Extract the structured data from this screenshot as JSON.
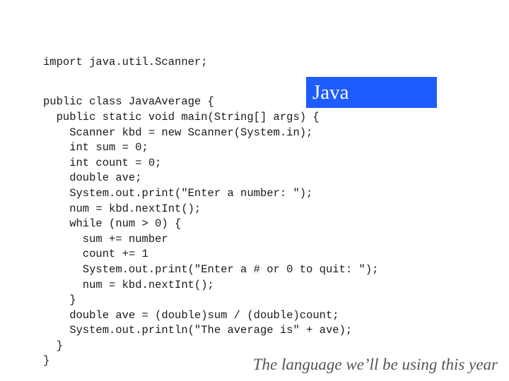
{
  "slide": {
    "title": "Java",
    "caption": "The language we’ll be using this year",
    "colors": {
      "title_box_background": "#1f5cff",
      "title_text": "#ffffff",
      "code_text": "#1a1a1a",
      "caption_text": "#555555"
    },
    "code_lines": [
      "import java.util.Scanner;",
      "",
      "public class JavaAverage {",
      "  public static void main(String[] args) {",
      "    Scanner kbd = new Scanner(System.in);",
      "    int sum = 0;",
      "    int count = 0;",
      "    double ave;",
      "    System.out.print(\"Enter a number: \");",
      "    num = kbd.nextInt();",
      "    while (num > 0) {",
      "      sum += number",
      "      count += 1",
      "      System.out.print(\"Enter a # or 0 to quit: \");",
      "      num = kbd.nextInt();",
      "    }",
      "    double ave = (double)sum / (double)count;",
      "    System.out.println(\"The average is\" + ave);",
      "  }",
      "}"
    ]
  }
}
